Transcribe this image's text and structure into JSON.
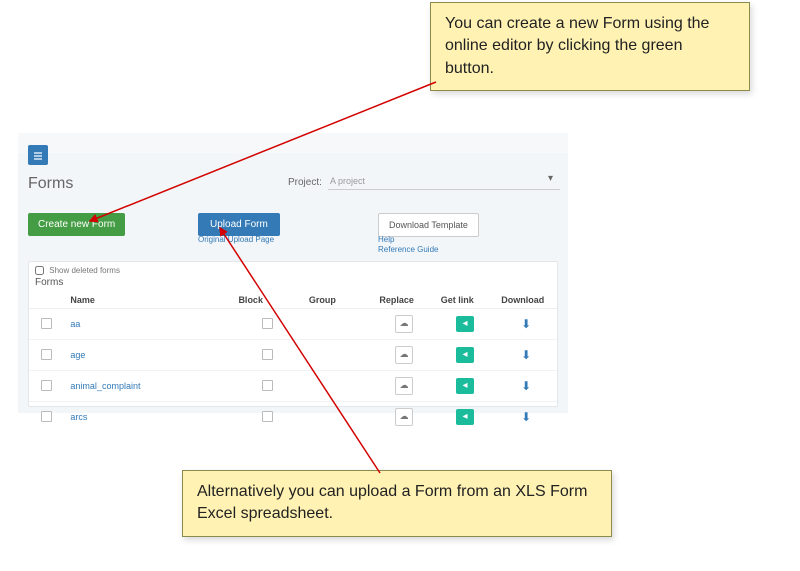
{
  "callouts": {
    "top": "You can create a new Form using the online editor by clicking the green button.",
    "bottom": "Alternatively you can upload a Form from an XLS Form Excel spreadsheet."
  },
  "screenshot": {
    "title": "Forms",
    "project_label": "Project:",
    "project_value": "A project",
    "create_btn": "Create new Form",
    "upload_btn": "Upload Form",
    "original_upload_link": "Original Upload Page",
    "download_template_btn": "Download Template",
    "help_link": "Help",
    "reference_link": "Reference Guide",
    "show_deleted_label": "Show deleted forms",
    "forms_heading": "Forms",
    "columns": {
      "name": "Name",
      "block": "Block",
      "group": "Group",
      "replace": "Replace",
      "get_link": "Get link",
      "download": "Download"
    },
    "rows": [
      {
        "name": "aa"
      },
      {
        "name": "age"
      },
      {
        "name": "animal_complaint"
      },
      {
        "name": "arcs"
      }
    ]
  }
}
